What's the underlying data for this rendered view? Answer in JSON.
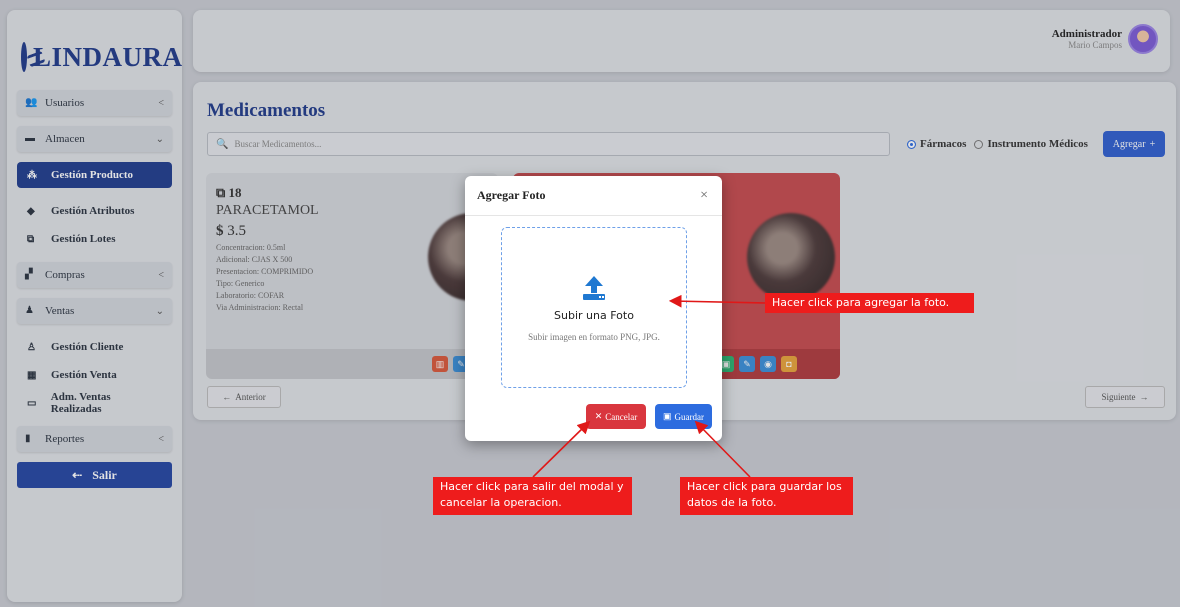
{
  "app": {
    "brand": "LINDAURA"
  },
  "sidebar": {
    "usuarios": "Usuarios",
    "almacen": "Almacen",
    "gestion_producto": "Gestión Producto",
    "gestion_atributos": "Gestión Atributos",
    "gestion_lotes": "Gestión Lotes",
    "compras": "Compras",
    "ventas": "Ventas",
    "gestion_cliente": "Gestión Cliente",
    "gestion_venta": "Gestión Venta",
    "adm_ventas": "Adm. Ventas Realizadas",
    "reportes": "Reportes",
    "salir": "Salir"
  },
  "header": {
    "role": "Administrador",
    "name": "Mario Campos"
  },
  "main": {
    "title": "Medicamentos",
    "search_placeholder": "Buscar Medicamentos...",
    "radio_farmacos": "Fármacos",
    "radio_instrumentos": "Instrumento Médicos",
    "add_label": "Agregar",
    "prev": "Anterior",
    "next": "Siguiente"
  },
  "card": {
    "id": "18",
    "name": "PARACETAMOL",
    "price": "3.5",
    "concentracion": "Concentracion: 0.5ml",
    "adicional": "Adicional: CJAS X 500",
    "presentacion": "Presentacion: COMPRIMIDO",
    "tipo": "Tipo: Generico",
    "laboratorio": "Laboratorio: COFAR",
    "via": "Via Administracion: Rectal"
  },
  "modal": {
    "title": "Agregar Foto",
    "upload_title": "Subir una Foto",
    "upload_sub": "Subir imagen en formato PNG, JPG.",
    "cancel": "Cancelar",
    "save": "Guardar"
  },
  "callouts": {
    "upload": "Hacer click para agregar la foto.",
    "cancel": "Hacer click para salir del modal y cancelar la operacion.",
    "save": "Hacer click para guardar los datos de la foto."
  },
  "colors": {
    "primary": "#1f3a8a",
    "accent": "#2e5fcf",
    "danger": "#d9363e",
    "callout": "#ee1c1c"
  }
}
